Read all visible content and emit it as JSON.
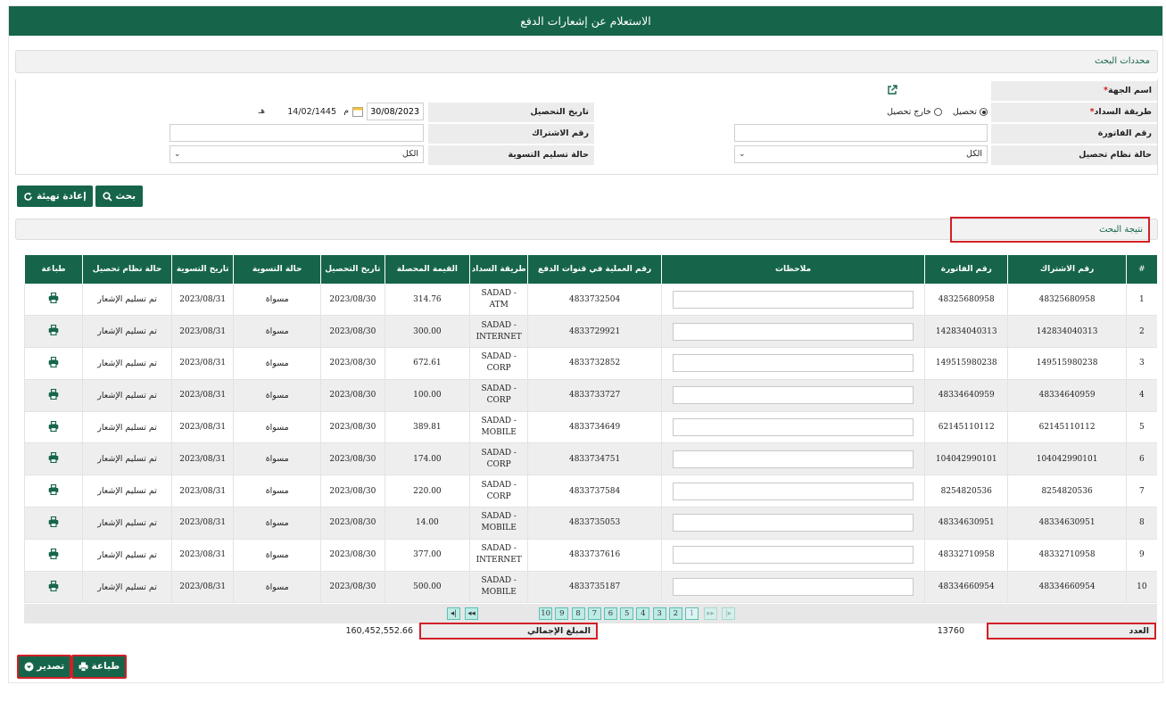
{
  "page_title": "الاستعلام عن إشعارات الدفع",
  "criteria": {
    "header": "محددات البحث",
    "entity_label": "اسم الجهة",
    "payment_method_label": "طريقة السداد",
    "payment_options": [
      "تحصيل",
      "خارج تحصيل"
    ],
    "collection_date_label": "تاريخ التحصيل",
    "date_gregorian": "30/08/2023",
    "gregorian_suffix": "م",
    "date_hijri": "14/02/1445",
    "hijri_suffix": "هـ",
    "invoice_label": "رقم الفاتورة",
    "invoice_value": "",
    "subscription_label": "رقم الاشتراك",
    "subscription_value": "",
    "collection_system_label": "حالة نظام تحصيل",
    "collection_system_value": "الكل",
    "settlement_delivery_label": "حالة تسليم التسوية",
    "settlement_delivery_value": "الكل",
    "search_button": "بحث",
    "reset_button": "إعادة تهيئة"
  },
  "results": {
    "header": "نتيجة البحث",
    "columns": [
      "#",
      "رقم الاشتراك",
      "رقم الفاتورة",
      "ملاحظات",
      "رقم العملية في قنوات الدفع",
      "طريقة السداد",
      "القيمة المحصلة",
      "تاريخ التحصيل",
      "حالة التسوية",
      "تاريخ التسوية",
      "حالة نظام تحصيل",
      "طباعة"
    ],
    "rows": [
      {
        "n": "1",
        "sub": "48325680958",
        "inv": "48325680958",
        "op": "4833732504",
        "method": "SADAD - ATM",
        "amount": "314.76",
        "cdate": "2023/08/30",
        "sstatus": "مسواة",
        "sdate": "2023/08/31",
        "sys": "تم تسليم الإشعار"
      },
      {
        "n": "2",
        "sub": "142834040313",
        "inv": "142834040313",
        "op": "4833729921",
        "method": "SADAD - INTERNET",
        "amount": "300.00",
        "cdate": "2023/08/30",
        "sstatus": "مسواة",
        "sdate": "2023/08/31",
        "sys": "تم تسليم الإشعار"
      },
      {
        "n": "3",
        "sub": "149515980238",
        "inv": "149515980238",
        "op": "4833732852",
        "method": "SADAD - CORP",
        "amount": "672.61",
        "cdate": "2023/08/30",
        "sstatus": "مسواة",
        "sdate": "2023/08/31",
        "sys": "تم تسليم الإشعار"
      },
      {
        "n": "4",
        "sub": "48334640959",
        "inv": "48334640959",
        "op": "4833733727",
        "method": "SADAD - CORP",
        "amount": "100.00",
        "cdate": "2023/08/30",
        "sstatus": "مسواة",
        "sdate": "2023/08/31",
        "sys": "تم تسليم الإشعار"
      },
      {
        "n": "5",
        "sub": "62145110112",
        "inv": "62145110112",
        "op": "4833734649",
        "method": "SADAD - MOBILE",
        "amount": "389.81",
        "cdate": "2023/08/30",
        "sstatus": "مسواة",
        "sdate": "2023/08/31",
        "sys": "تم تسليم الإشعار"
      },
      {
        "n": "6",
        "sub": "104042990101",
        "inv": "104042990101",
        "op": "4833734751",
        "method": "SADAD - CORP",
        "amount": "174.00",
        "cdate": "2023/08/30",
        "sstatus": "مسواة",
        "sdate": "2023/08/31",
        "sys": "تم تسليم الإشعار"
      },
      {
        "n": "7",
        "sub": "8254820536",
        "inv": "8254820536",
        "op": "4833737584",
        "method": "SADAD - CORP",
        "amount": "220.00",
        "cdate": "2023/08/30",
        "sstatus": "مسواة",
        "sdate": "2023/08/31",
        "sys": "تم تسليم الإشعار"
      },
      {
        "n": "8",
        "sub": "48334630951",
        "inv": "48334630951",
        "op": "4833735053",
        "method": "SADAD - MOBILE",
        "amount": "14.00",
        "cdate": "2023/08/30",
        "sstatus": "مسواة",
        "sdate": "2023/08/31",
        "sys": "تم تسليم الإشعار"
      },
      {
        "n": "9",
        "sub": "48332710958",
        "inv": "48332710958",
        "op": "4833737616",
        "method": "SADAD - INTERNET",
        "amount": "377.00",
        "cdate": "2023/08/30",
        "sstatus": "مسواة",
        "sdate": "2023/08/31",
        "sys": "تم تسليم الإشعار"
      },
      {
        "n": "10",
        "sub": "48334660954",
        "inv": "48334660954",
        "op": "4833735187",
        "method": "SADAD - MOBILE",
        "amount": "500.00",
        "cdate": "2023/08/30",
        "sstatus": "مسواة",
        "sdate": "2023/08/31",
        "sys": "تم تسليم الإشعار"
      }
    ],
    "pages": [
      "1",
      "2",
      "3",
      "4",
      "5",
      "6",
      "7",
      "8",
      "9",
      "10"
    ],
    "current_page": "1",
    "count_label": "العدد",
    "count_value": "13760",
    "total_label": "المبلغ الإجمالي",
    "total_value": "160,452,552.66",
    "print_button": "طباعة",
    "export_button": "تصدير"
  },
  "colors": {
    "primary": "#16654a",
    "highlight": "#d21f26",
    "pager": "#bdece5"
  }
}
